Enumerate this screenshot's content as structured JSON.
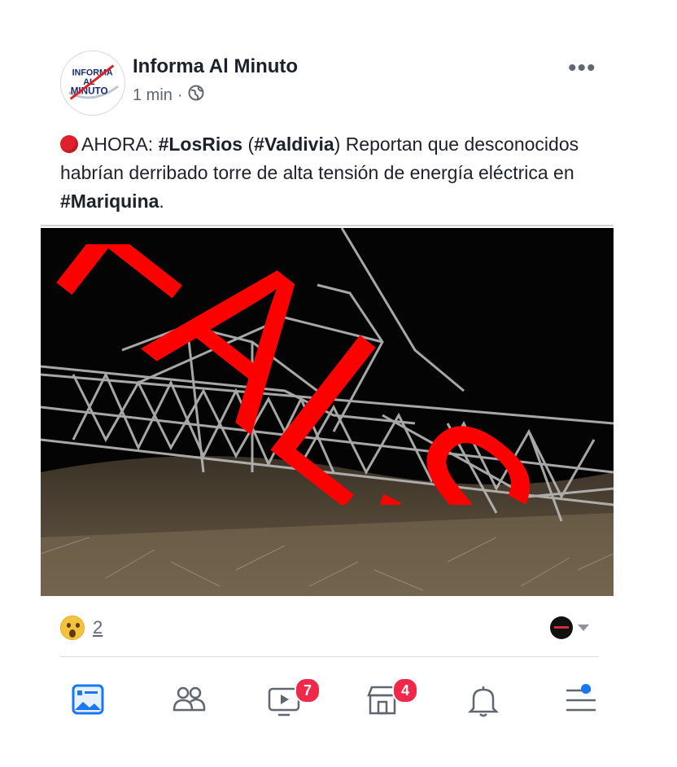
{
  "post": {
    "author": "Informa Al Minuto",
    "time": "1 min",
    "separator": "·",
    "avatar_text": [
      "INFORMA",
      "AL",
      "MINUTO"
    ],
    "text": {
      "prefix": "AHORA: ",
      "tag1": "#LosRios",
      "paren_open": " (",
      "tag2": "#Valdivia",
      "middle": ") Reportan que desconocidos habrían derribado torre de alta tensión de energía eléctrica en ",
      "tag3": "#Mariquina",
      "suffix": "."
    },
    "stamp": "FALSO",
    "reaction_count": "2"
  },
  "icons": {
    "more": "more-horiz-icon",
    "audience": "globe-icon",
    "reaction": "wow-reaction-icon"
  },
  "tabbar": {
    "items": [
      {
        "name": "news-feed",
        "badge": ""
      },
      {
        "name": "friends",
        "badge": ""
      },
      {
        "name": "watch",
        "badge": "7"
      },
      {
        "name": "marketplace",
        "badge": "4"
      },
      {
        "name": "notifications",
        "badge": ""
      },
      {
        "name": "menu",
        "badge": ""
      }
    ]
  },
  "colors": {
    "stamp": "#ff0000",
    "brand": "#1877f2",
    "badge": "#f02849",
    "live": "#e0202a"
  }
}
